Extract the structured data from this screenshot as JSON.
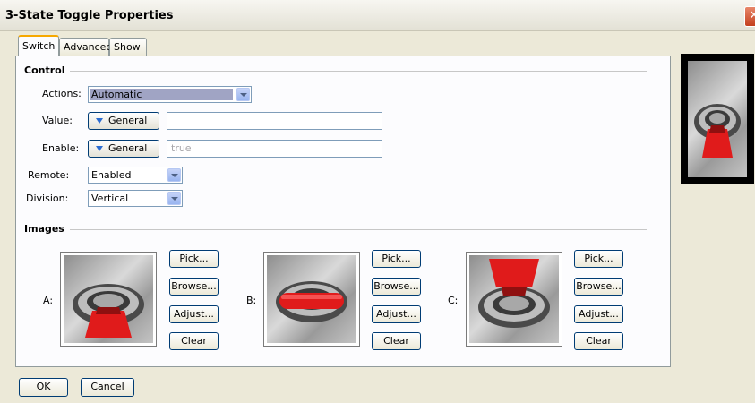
{
  "window": {
    "title": "3-State Toggle Properties",
    "close_glyph": "✕"
  },
  "tabs": [
    {
      "label": "Switch",
      "active": true
    },
    {
      "label": "Advanced",
      "active": false
    },
    {
      "label": "Show",
      "active": false
    }
  ],
  "control": {
    "heading": "Control",
    "actions": {
      "label": "Actions:",
      "value": "Automatic"
    },
    "value": {
      "label": "Value:",
      "button": "General",
      "text": ""
    },
    "enable": {
      "label": "Enable:",
      "button": "General",
      "text": "true"
    },
    "remote": {
      "label": "Remote:",
      "value": "Enabled"
    },
    "division": {
      "label": "Division:",
      "value": "Vertical"
    }
  },
  "images": {
    "heading": "Images",
    "slots": [
      {
        "label": "A:",
        "state": "down"
      },
      {
        "label": "B:",
        "state": "middle"
      },
      {
        "label": "C:",
        "state": "up"
      }
    ],
    "buttons": {
      "pick": "Pick...",
      "browse": "Browse...",
      "adjust": "Adjust...",
      "clear": "Clear"
    }
  },
  "footer": {
    "ok": "OK",
    "cancel": "Cancel"
  },
  "colors": {
    "accent_red": "#e01b1b",
    "tab_highlight": "#f6a800",
    "button_border": "#003c74"
  }
}
